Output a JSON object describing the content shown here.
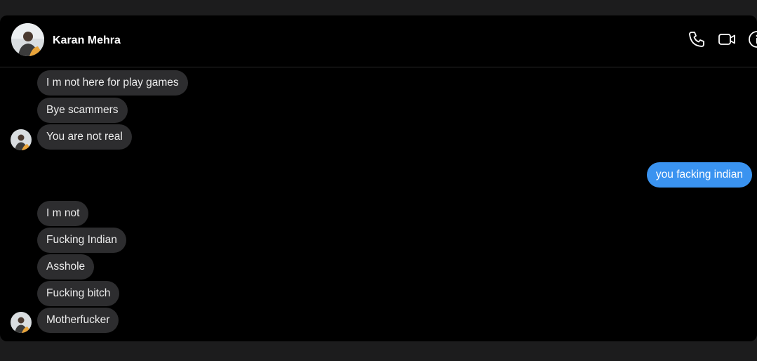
{
  "header": {
    "contact_name": "Karan Mehra",
    "icons": [
      "phone-icon",
      "video-camera-icon",
      "info-icon"
    ]
  },
  "colors": {
    "page_background": "#1c1c1d",
    "chat_background": "#000000",
    "incoming_bubble": "#2d2d2f",
    "outgoing_bubble": "#3a93f0",
    "text": "#ececec"
  },
  "messages": [
    {
      "text": "I m not here for play games",
      "direction": "incoming"
    },
    {
      "text": "Bye scammers",
      "direction": "incoming"
    },
    {
      "text": "You are not real",
      "direction": "incoming"
    },
    {
      "text": "you facking indian",
      "direction": "outgoing"
    },
    {
      "text": "I m not",
      "direction": "incoming"
    },
    {
      "text": "Fucking Indian",
      "direction": "incoming"
    },
    {
      "text": "Asshole",
      "direction": "incoming"
    },
    {
      "text": "Fucking bitch",
      "direction": "incoming"
    },
    {
      "text": "Motherfucker",
      "direction": "incoming"
    }
  ]
}
